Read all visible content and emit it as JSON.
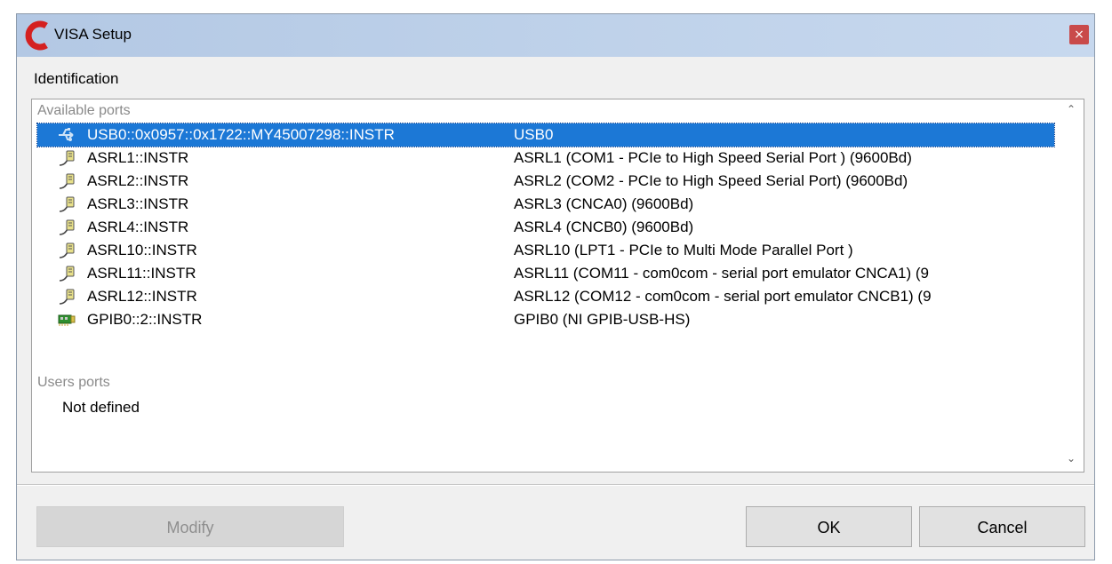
{
  "window": {
    "title": "VISA Setup",
    "close_symbol": "×",
    "app_icon": "red-c-logo-icon"
  },
  "identification": {
    "label": "Identification"
  },
  "available_ports": {
    "header": "Available ports",
    "items": [
      {
        "icon": "usb-icon",
        "name": "USB0::0x0957::0x1722::MY45007298::INSTR",
        "description": "USB0",
        "selected": true
      },
      {
        "icon": "serial-port-icon",
        "name": "ASRL1::INSTR",
        "description": "ASRL1  (COM1 - PCIe to High Speed Serial Port ) (9600Bd)"
      },
      {
        "icon": "serial-port-icon",
        "name": "ASRL2::INSTR",
        "description": "ASRL2  (COM2 - PCIe to High Speed Serial Port) (9600Bd)"
      },
      {
        "icon": "serial-port-icon",
        "name": "ASRL3::INSTR",
        "description": "ASRL3  (CNCA0) (9600Bd)"
      },
      {
        "icon": "serial-port-icon",
        "name": "ASRL4::INSTR",
        "description": "ASRL4  (CNCB0) (9600Bd)"
      },
      {
        "icon": "serial-port-icon",
        "name": "ASRL10::INSTR",
        "description": "ASRL10  (LPT1 - PCIe to Multi Mode Parallel Port )"
      },
      {
        "icon": "serial-port-icon",
        "name": "ASRL11::INSTR",
        "description": "ASRL11  (COM11 - com0com - serial port emulator CNCA1) (9"
      },
      {
        "icon": "serial-port-icon",
        "name": "ASRL12::INSTR",
        "description": "ASRL12  (COM12 - com0com - serial port emulator CNCB1) (9"
      },
      {
        "icon": "gpib-card-icon",
        "name": "GPIB0::2::INSTR",
        "description": "GPIB0  (NI GPIB-USB-HS)"
      }
    ]
  },
  "users_ports": {
    "header": "Users ports",
    "empty_text": "Not defined"
  },
  "scrollbar": {
    "up_symbol": "⌃",
    "down_symbol": "⌄"
  },
  "buttons": {
    "modify": "Modify",
    "ok": "OK",
    "cancel": "Cancel"
  },
  "colors": {
    "selection": "#1c78d6",
    "titlebar": "#bfd2ea",
    "close_button": "#c94a4a",
    "logo": "#d42020"
  }
}
